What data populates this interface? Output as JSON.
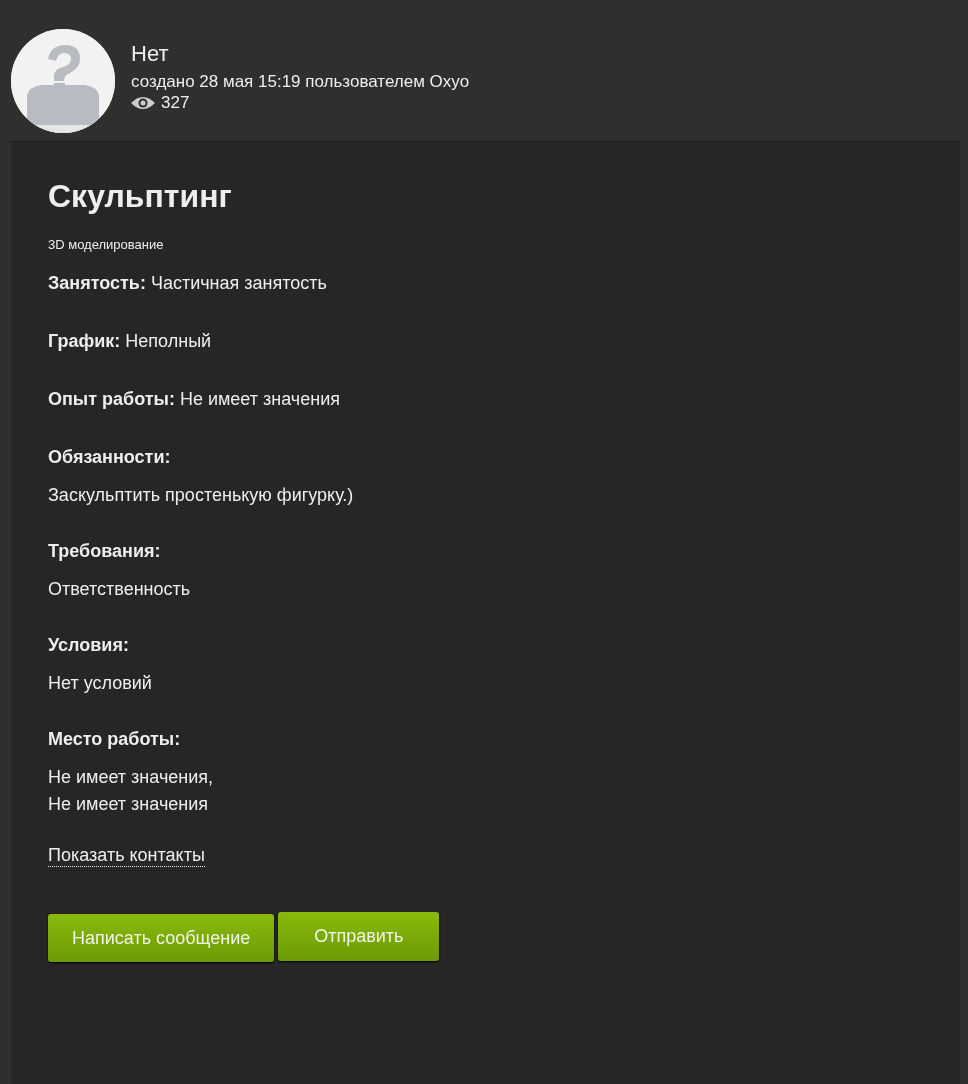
{
  "author": {
    "name": "Нет",
    "created": "создано 28 мая 15:19 пользователем Oxyo",
    "views": "327"
  },
  "vacancy": {
    "title": "Скульптинг",
    "category": "3D моделирование",
    "fields": [
      {
        "kind": "inline",
        "label": "Занятость:",
        "lines": [
          "Частичная занятость"
        ]
      },
      {
        "kind": "inline",
        "label": "График:",
        "lines": [
          "Неполный"
        ]
      },
      {
        "kind": "inline",
        "label": "Опыт работы:",
        "lines": [
          "Не имеет значения"
        ]
      },
      {
        "kind": "block",
        "label": "Обязанности:",
        "lines": [
          "Заскульптить простенькую фигурку.)"
        ]
      },
      {
        "kind": "block",
        "label": "Требования:",
        "lines": [
          "Ответственность"
        ]
      },
      {
        "kind": "block",
        "label": "Условия:",
        "lines": [
          "Нет условий"
        ]
      },
      {
        "kind": "block",
        "label": "Место работы:",
        "lines": [
          "Не имеет значения,",
          "Не имеет значения"
        ]
      }
    ],
    "contacts_link": "Показать контакты",
    "buttons": [
      "Написать сообщение",
      "Отправить"
    ]
  }
}
